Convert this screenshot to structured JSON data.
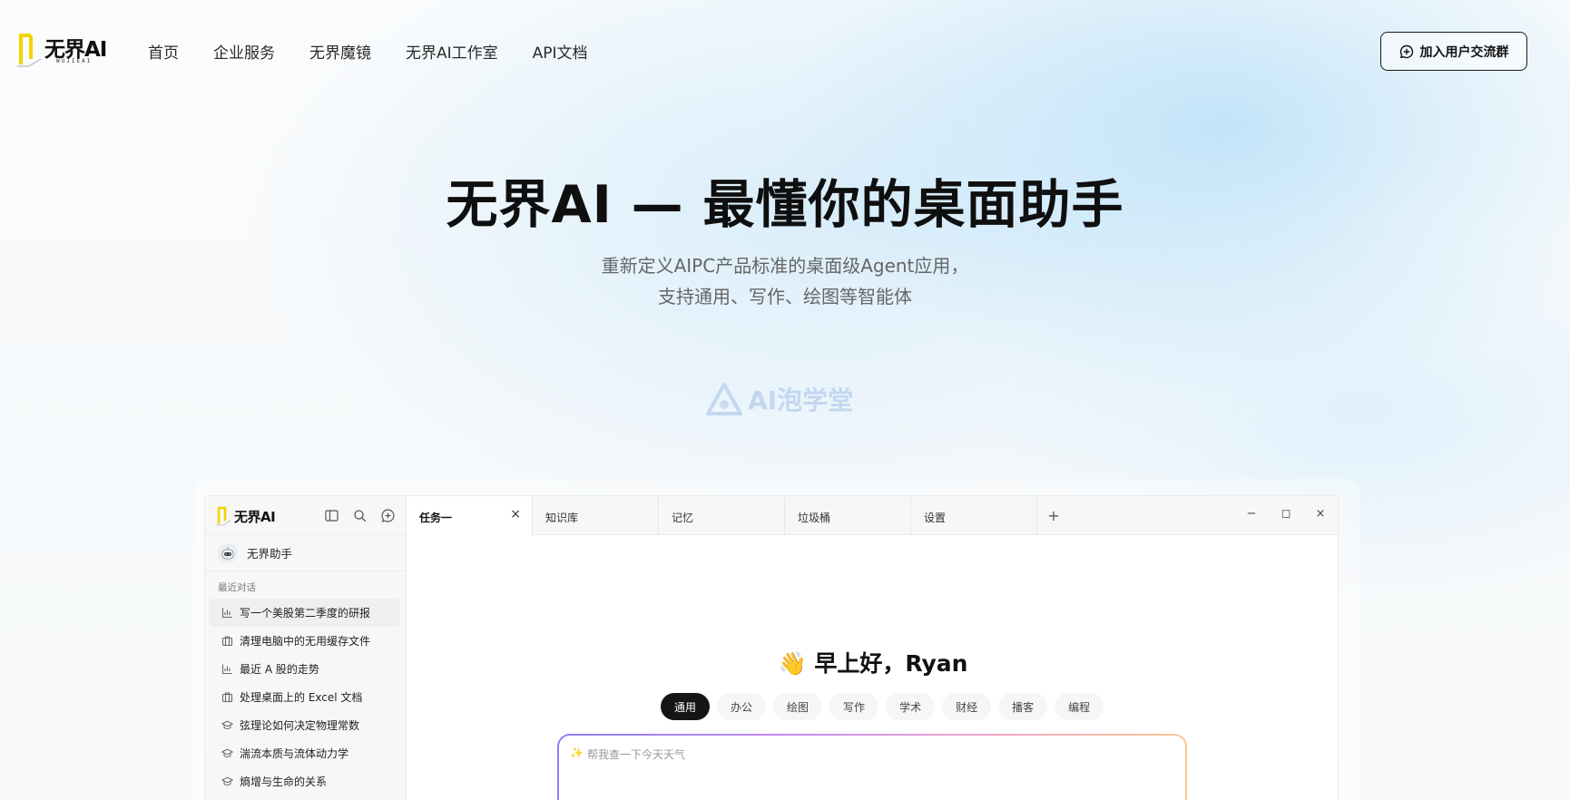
{
  "nav": {
    "logo_text": "无界AI",
    "logo_sub": "WUJIEAI",
    "links": [
      "首页",
      "企业服务",
      "无界魔镜",
      "无界AI工作室",
      "API文档"
    ],
    "join_button": "加入用户交流群"
  },
  "hero": {
    "title": "无界AI — 最懂你的桌面助手",
    "subtitle_line1": "重新定义AIPC产品标准的桌面级Agent应用，",
    "subtitle_line2": "支持通用、写作、绘图等智能体"
  },
  "watermark": "AI泡学堂",
  "app": {
    "logo_text": "无界AI",
    "assistant_name": "无界助手",
    "recent_label": "最近对话",
    "conversations": [
      {
        "label": "写一个美股第二季度的研报",
        "icon": "chart-icon"
      },
      {
        "label": "清理电脑中的无用缓存文件",
        "icon": "briefcase-icon"
      },
      {
        "label": "最近 A 股的走势",
        "icon": "chart-icon"
      },
      {
        "label": "处理桌面上的 Excel 文档",
        "icon": "briefcase-icon"
      },
      {
        "label": "弦理论如何决定物理常数",
        "icon": "graduation-cap-icon"
      },
      {
        "label": "湍流本质与流体动力学",
        "icon": "graduation-cap-icon"
      },
      {
        "label": "熵增与生命的关系",
        "icon": "graduation-cap-icon"
      }
    ],
    "tabs": [
      "任务一",
      "知识库",
      "记忆",
      "垃圾桶",
      "设置"
    ],
    "tab_close": "×",
    "tab_add": "+",
    "window_controls": {
      "minimize": "−",
      "maximize": "◻",
      "close": "×"
    },
    "greeting_emoji": "👋",
    "greeting": "早上好，Ryan",
    "categories": [
      "通用",
      "办公",
      "绘图",
      "写作",
      "学术",
      "财经",
      "播客",
      "编程"
    ],
    "input_icon": "✨",
    "input_placeholder": "帮我查一下今天天气"
  }
}
